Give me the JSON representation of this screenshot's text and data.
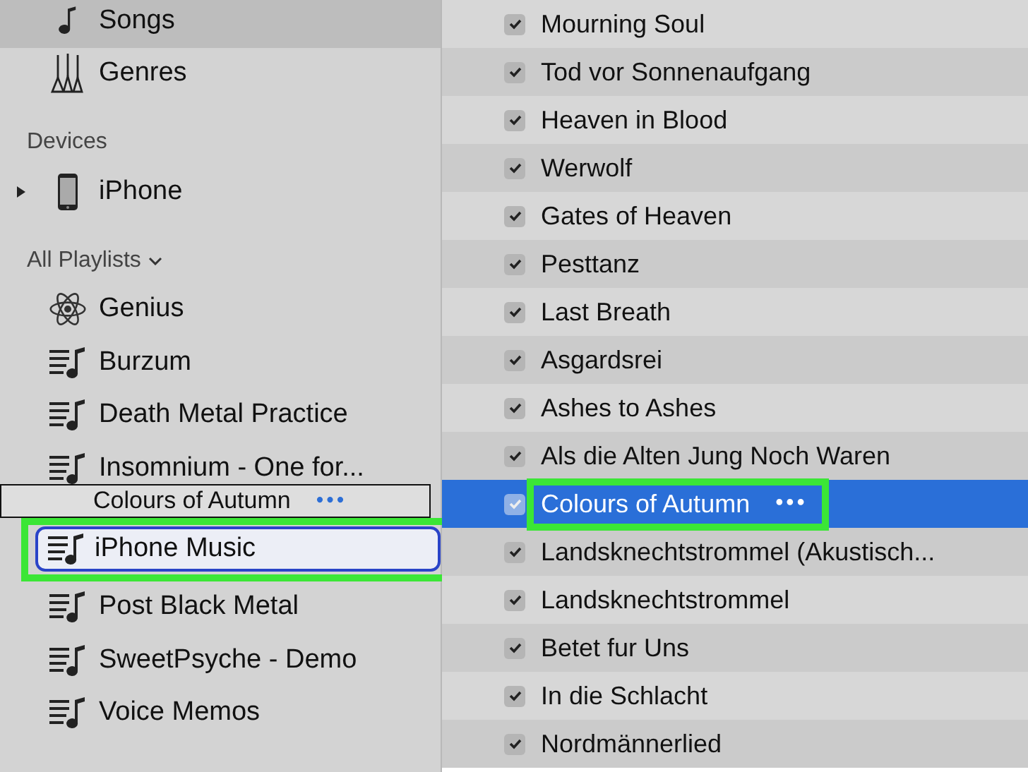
{
  "sidebar": {
    "items": [
      {
        "kind": "library",
        "label": "Songs",
        "selected": true
      },
      {
        "kind": "library",
        "label": "Genres",
        "selected": false
      },
      {
        "kind": "header",
        "label": "Devices"
      },
      {
        "kind": "device",
        "label": "iPhone",
        "expanded": false,
        "selected": false
      },
      {
        "kind": "header",
        "label": "All Playlists",
        "expanded": true
      },
      {
        "kind": "genius",
        "label": "Genius",
        "selected": false,
        "drop_target": false
      },
      {
        "kind": "playlist",
        "label": "Burzum",
        "selected": false,
        "drop_target": false
      },
      {
        "kind": "playlist",
        "label": "Death Metal Practice",
        "selected": false,
        "drop_target": false
      },
      {
        "kind": "playlist",
        "label": "Insomnium - One for...",
        "selected": false,
        "drop_target": false
      },
      {
        "kind": "playlist",
        "label": "iPhone Music",
        "selected": false,
        "drop_target": true,
        "highlighted": true
      },
      {
        "kind": "playlist",
        "label": "Post Black Metal",
        "selected": false,
        "drop_target": false
      },
      {
        "kind": "playlist",
        "label": "SweetPsyche - Demo",
        "selected": false,
        "drop_target": false
      },
      {
        "kind": "playlist",
        "label": "Voice Memos",
        "selected": false,
        "drop_target": false
      }
    ]
  },
  "drag_ghost": {
    "title": "Colours of Autumn",
    "more": "•••"
  },
  "tracks": [
    {
      "title": "Mourning Soul",
      "checked": true,
      "selected": false
    },
    {
      "title": "Tod vor Sonnenaufgang",
      "checked": true,
      "selected": false
    },
    {
      "title": "Heaven in Blood",
      "checked": true,
      "selected": false
    },
    {
      "title": "Werwolf",
      "checked": true,
      "selected": false
    },
    {
      "title": "Gates of Heaven",
      "checked": true,
      "selected": false
    },
    {
      "title": "Pesttanz",
      "checked": true,
      "selected": false
    },
    {
      "title": "Last Breath",
      "checked": true,
      "selected": false
    },
    {
      "title": "Asgardsrei",
      "checked": true,
      "selected": false
    },
    {
      "title": "Ashes to Ashes",
      "checked": true,
      "selected": false
    },
    {
      "title": "Als die Alten Jung Noch Waren",
      "checked": true,
      "selected": false
    },
    {
      "title": "Colours of Autumn",
      "more": "•••",
      "checked": true,
      "selected": true,
      "highlighted": true
    },
    {
      "title": "Landsknechtstrommel  (Akustisch...",
      "checked": true,
      "selected": false
    },
    {
      "title": "Landsknechtstrommel",
      "checked": true,
      "selected": false
    },
    {
      "title": "Betet fur Uns",
      "checked": true,
      "selected": false
    },
    {
      "title": "In die Schlacht",
      "checked": true,
      "selected": false
    },
    {
      "title": "Nordmännerlied",
      "checked": true,
      "selected": false
    }
  ]
}
